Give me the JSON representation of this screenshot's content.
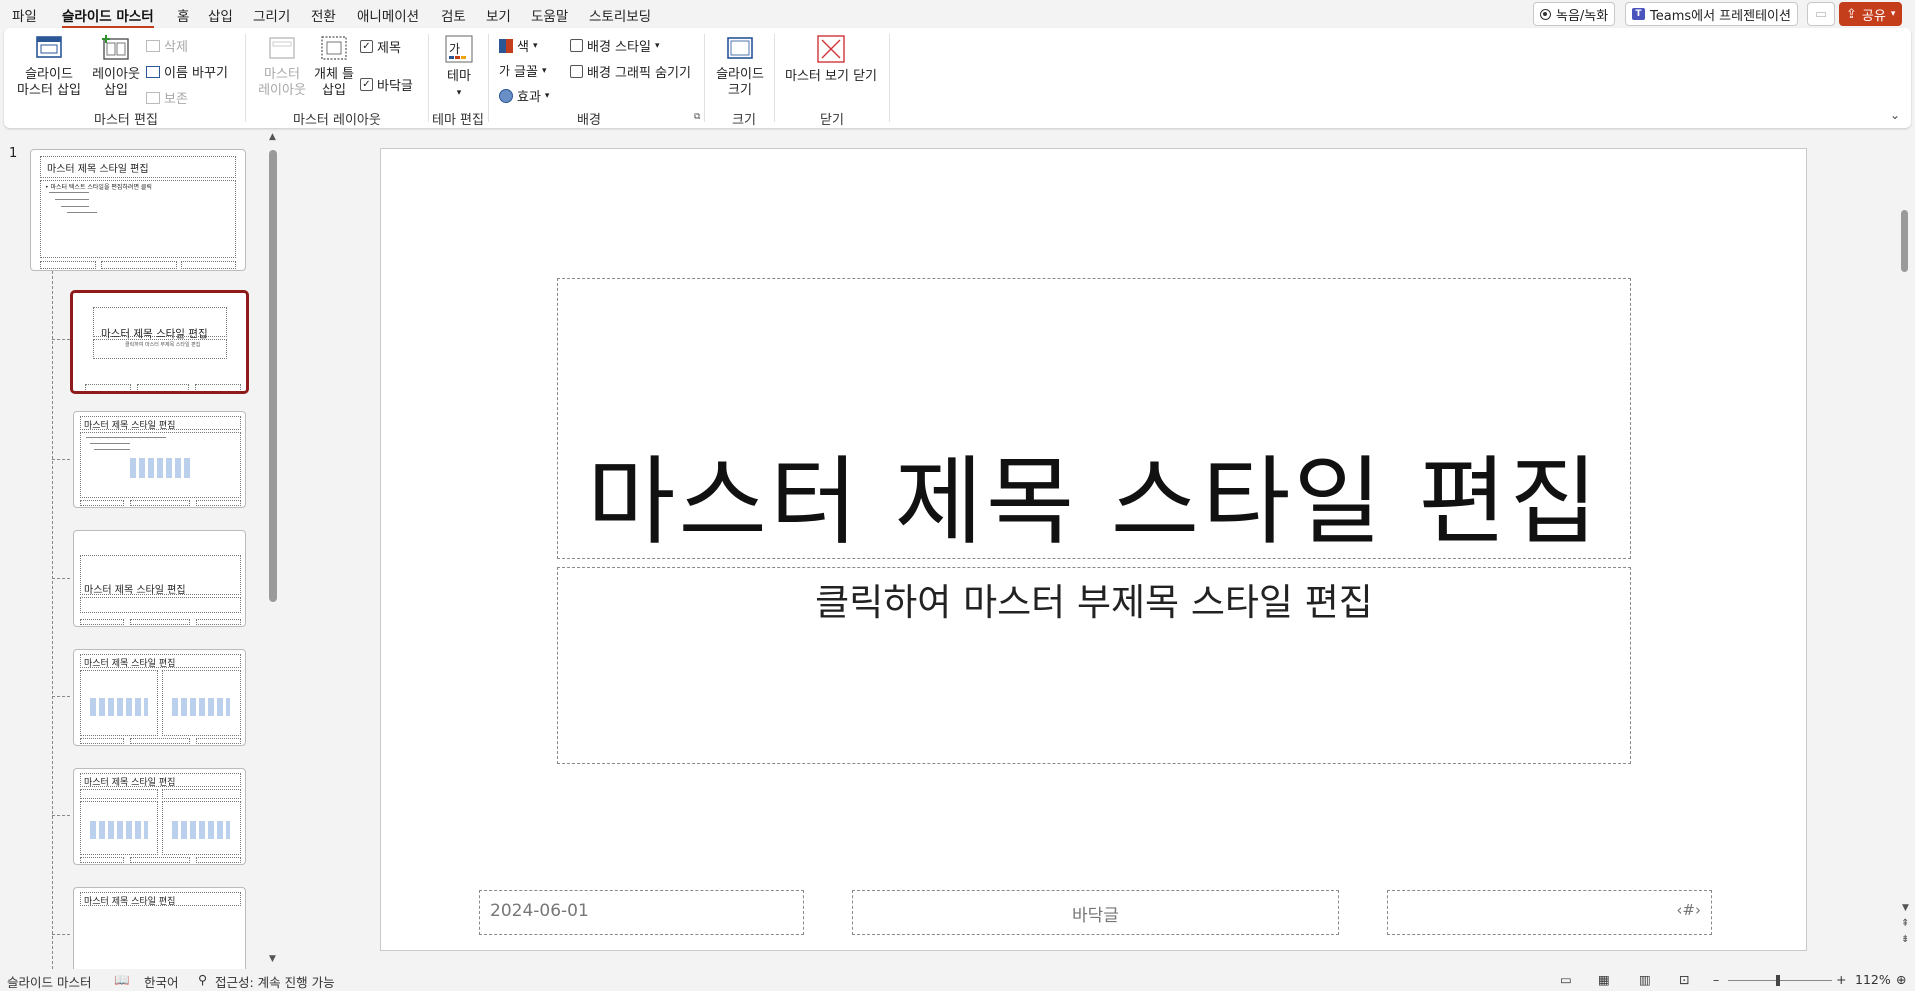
{
  "tabs": [
    "파일",
    "슬라이드 마스터",
    "홈",
    "삽입",
    "그리기",
    "전환",
    "애니메이션",
    "검토",
    "보기",
    "도움말",
    "스토리보딩"
  ],
  "active_tab": "슬라이드 마스터",
  "top_right": {
    "record": "녹음/녹화",
    "teams": "Teams에서 프레젠테이션",
    "share": "공유"
  },
  "ribbon": {
    "master_edit": {
      "insert_master": "슬라이드\n마스터 삽입",
      "insert_layout": "레이아웃\n삽입",
      "delete": "삭제",
      "rename": "이름 바꾸기",
      "preserve": "보존",
      "label": "마스터 편집"
    },
    "master_layout": {
      "master_layout_btn": "마스터\n레이아웃",
      "insert_placeholder": "개체 틀\n삽입",
      "title_chk": "제목",
      "footer_chk": "바닥글",
      "label": "마스터 레이아웃"
    },
    "theme_edit": {
      "theme": "테마",
      "label": "테마 편집"
    },
    "background": {
      "colors": "색",
      "fonts": "글꼴",
      "effects": "효과",
      "bg_styles": "배경 스타일",
      "hide_bg": "배경 그래픽 숨기기",
      "label": "배경"
    },
    "size": {
      "slide_size": "슬라이드\n크기",
      "label": "크기"
    },
    "close": {
      "close_master": "마스터 보기 닫기",
      "label": "닫기"
    }
  },
  "thumbnails": {
    "slide_number": "1",
    "master_title": "마스터 제목 스타일 편집",
    "master_text": "• 마스터 텍스트 스타일을 편집하려면 클릭",
    "layout_subtitle": "클릭하여 마스터 부제목 스타일 편집"
  },
  "slide": {
    "title": "마스터 제목 스타일 편집",
    "subtitle": "클릭하여 마스터 부제목 스타일 편집",
    "date": "2024-06-01",
    "footer": "바닥글",
    "page_num": "‹#›"
  },
  "status": {
    "view": "슬라이드 마스터",
    "language": "한국어",
    "accessibility": "접근성: 계속 진행 가능",
    "zoom": "112%"
  },
  "colors": {
    "accent": "#c43e1c",
    "selected_border": "#8e1a1a"
  }
}
